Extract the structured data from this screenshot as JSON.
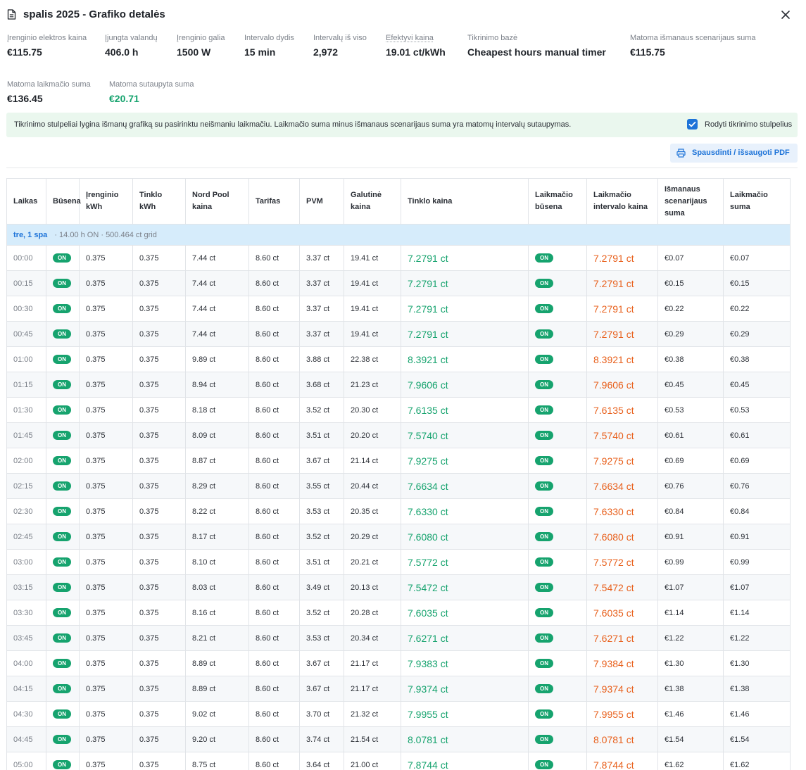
{
  "header": {
    "title": "spalis 2025 - Grafiko detalės"
  },
  "stats": [
    {
      "label": "Įrenginio elektros kaina",
      "value": "€115.75"
    },
    {
      "label": "Įjungta valandų",
      "value": "406.0 h"
    },
    {
      "label": "Įrenginio galia",
      "value": "1500 W"
    },
    {
      "label": "Intervalo dydis",
      "value": "15 min"
    },
    {
      "label": "Intervalų iš viso",
      "value": "2,972"
    },
    {
      "label": "Efektyvi kaina",
      "value": "19.01 ct/kWh"
    },
    {
      "label": "Tikrinimo bazė",
      "value": "Cheapest hours manual timer"
    },
    {
      "label": "Matoma išmanaus scenarijaus suma",
      "value": "€115.75"
    },
    {
      "label": "Matoma laikmačio suma",
      "value": "€136.45"
    },
    {
      "label": "Matoma sutaupyta suma",
      "value": "€20.71"
    }
  ],
  "info": {
    "text": "Tikrinimo stulpeliai lygina išmanų grafiką su pasirinktu neišmaniu laikmačiu. Laikmačio suma minus išmanaus scenarijaus suma yra matomų intervalų sutaupymas.",
    "checkbox_label": "Rodyti tikrinimo stulpelius",
    "checked": true
  },
  "toolbar": {
    "print_label": "Spausdinti / išsaugoti PDF"
  },
  "table": {
    "columns": [
      "Laikas",
      "Būsena",
      "Įrenginio kWh",
      "Tinklo kWh",
      "Nord Pool kaina",
      "Tarifas",
      "PVM",
      "Galutinė kaina",
      "Tinklo kaina",
      "Laikmačio būsena",
      "Laikmačio intervalo kaina",
      "Išmanaus scenarijaus suma",
      "Laikmačio suma"
    ],
    "day": {
      "label": "tre, 1 spa",
      "meta": "· 14.00 h ON · 500.464 ct grid"
    },
    "rows": [
      [
        "00:00",
        "ON",
        "0.375",
        "0.375",
        "7.44 ct",
        "8.60 ct",
        "3.37 ct",
        "19.41 ct",
        "7.2791 ct",
        "ON",
        "7.2791 ct",
        "€0.07",
        "€0.07"
      ],
      [
        "00:15",
        "ON",
        "0.375",
        "0.375",
        "7.44 ct",
        "8.60 ct",
        "3.37 ct",
        "19.41 ct",
        "7.2791 ct",
        "ON",
        "7.2791 ct",
        "€0.15",
        "€0.15"
      ],
      [
        "00:30",
        "ON",
        "0.375",
        "0.375",
        "7.44 ct",
        "8.60 ct",
        "3.37 ct",
        "19.41 ct",
        "7.2791 ct",
        "ON",
        "7.2791 ct",
        "€0.22",
        "€0.22"
      ],
      [
        "00:45",
        "ON",
        "0.375",
        "0.375",
        "7.44 ct",
        "8.60 ct",
        "3.37 ct",
        "19.41 ct",
        "7.2791 ct",
        "ON",
        "7.2791 ct",
        "€0.29",
        "€0.29"
      ],
      [
        "01:00",
        "ON",
        "0.375",
        "0.375",
        "9.89 ct",
        "8.60 ct",
        "3.88 ct",
        "22.38 ct",
        "8.3921 ct",
        "ON",
        "8.3921 ct",
        "€0.38",
        "€0.38"
      ],
      [
        "01:15",
        "ON",
        "0.375",
        "0.375",
        "8.94 ct",
        "8.60 ct",
        "3.68 ct",
        "21.23 ct",
        "7.9606 ct",
        "ON",
        "7.9606 ct",
        "€0.45",
        "€0.45"
      ],
      [
        "01:30",
        "ON",
        "0.375",
        "0.375",
        "8.18 ct",
        "8.60 ct",
        "3.52 ct",
        "20.30 ct",
        "7.6135 ct",
        "ON",
        "7.6135 ct",
        "€0.53",
        "€0.53"
      ],
      [
        "01:45",
        "ON",
        "0.375",
        "0.375",
        "8.09 ct",
        "8.60 ct",
        "3.51 ct",
        "20.20 ct",
        "7.5740 ct",
        "ON",
        "7.5740 ct",
        "€0.61",
        "€0.61"
      ],
      [
        "02:00",
        "ON",
        "0.375",
        "0.375",
        "8.87 ct",
        "8.60 ct",
        "3.67 ct",
        "21.14 ct",
        "7.9275 ct",
        "ON",
        "7.9275 ct",
        "€0.69",
        "€0.69"
      ],
      [
        "02:15",
        "ON",
        "0.375",
        "0.375",
        "8.29 ct",
        "8.60 ct",
        "3.55 ct",
        "20.44 ct",
        "7.6634 ct",
        "ON",
        "7.6634 ct",
        "€0.76",
        "€0.76"
      ],
      [
        "02:30",
        "ON",
        "0.375",
        "0.375",
        "8.22 ct",
        "8.60 ct",
        "3.53 ct",
        "20.35 ct",
        "7.6330 ct",
        "ON",
        "7.6330 ct",
        "€0.84",
        "€0.84"
      ],
      [
        "02:45",
        "ON",
        "0.375",
        "0.375",
        "8.17 ct",
        "8.60 ct",
        "3.52 ct",
        "20.29 ct",
        "7.6080 ct",
        "ON",
        "7.6080 ct",
        "€0.91",
        "€0.91"
      ],
      [
        "03:00",
        "ON",
        "0.375",
        "0.375",
        "8.10 ct",
        "8.60 ct",
        "3.51 ct",
        "20.21 ct",
        "7.5772 ct",
        "ON",
        "7.5772 ct",
        "€0.99",
        "€0.99"
      ],
      [
        "03:15",
        "ON",
        "0.375",
        "0.375",
        "8.03 ct",
        "8.60 ct",
        "3.49 ct",
        "20.13 ct",
        "7.5472 ct",
        "ON",
        "7.5472 ct",
        "€1.07",
        "€1.07"
      ],
      [
        "03:30",
        "ON",
        "0.375",
        "0.375",
        "8.16 ct",
        "8.60 ct",
        "3.52 ct",
        "20.28 ct",
        "7.6035 ct",
        "ON",
        "7.6035 ct",
        "€1.14",
        "€1.14"
      ],
      [
        "03:45",
        "ON",
        "0.375",
        "0.375",
        "8.21 ct",
        "8.60 ct",
        "3.53 ct",
        "20.34 ct",
        "7.6271 ct",
        "ON",
        "7.6271 ct",
        "€1.22",
        "€1.22"
      ],
      [
        "04:00",
        "ON",
        "0.375",
        "0.375",
        "8.89 ct",
        "8.60 ct",
        "3.67 ct",
        "21.17 ct",
        "7.9383 ct",
        "ON",
        "7.9384 ct",
        "€1.30",
        "€1.30"
      ],
      [
        "04:15",
        "ON",
        "0.375",
        "0.375",
        "8.89 ct",
        "8.60 ct",
        "3.67 ct",
        "21.17 ct",
        "7.9374 ct",
        "ON",
        "7.9374 ct",
        "€1.38",
        "€1.38"
      ],
      [
        "04:30",
        "ON",
        "0.375",
        "0.375",
        "9.02 ct",
        "8.60 ct",
        "3.70 ct",
        "21.32 ct",
        "7.9955 ct",
        "ON",
        "7.9955 ct",
        "€1.46",
        "€1.46"
      ],
      [
        "04:45",
        "ON",
        "0.375",
        "0.375",
        "9.20 ct",
        "8.60 ct",
        "3.74 ct",
        "21.54 ct",
        "8.0781 ct",
        "ON",
        "8.0781 ct",
        "€1.54",
        "€1.54"
      ],
      [
        "05:00",
        "ON",
        "0.375",
        "0.375",
        "8.75 ct",
        "8.60 ct",
        "3.64 ct",
        "21.00 ct",
        "7.8744 ct",
        "ON",
        "7.8744 ct",
        "€1.62",
        "€1.62"
      ]
    ]
  }
}
